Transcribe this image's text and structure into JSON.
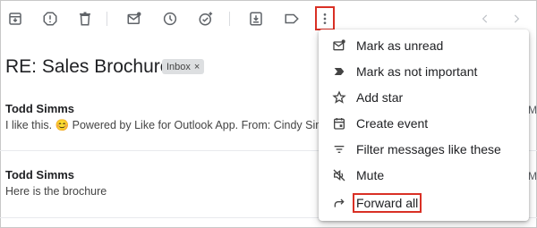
{
  "toolbar": {
    "icons": [
      "archive-icon",
      "report-spam-icon",
      "delete-icon",
      "mark-unread-icon",
      "snooze-icon",
      "add-task-icon",
      "move-to-icon",
      "label-icon",
      "more-options-icon",
      "previous-icon",
      "next-icon"
    ]
  },
  "email": {
    "subject": "RE: Sales Brochure",
    "label_chip": "Inbox",
    "chip_close": "×"
  },
  "messages": [
    {
      "sender": "Todd Simms",
      "snippet": "I like this. 😊 Powered by Like for Outlook App. From: Cindy Simm",
      "right_edge": "M"
    },
    {
      "sender": "Todd Simms",
      "snippet": "Here is the brochure",
      "right_edge": "M"
    }
  ],
  "menu": {
    "items": [
      {
        "label": "Mark as unread",
        "icon": "mark-unread-icon"
      },
      {
        "label": "Mark as not important",
        "icon": "not-important-icon"
      },
      {
        "label": "Add star",
        "icon": "star-icon"
      },
      {
        "label": "Create event",
        "icon": "calendar-icon"
      },
      {
        "label": "Filter messages like these",
        "icon": "filter-icon"
      },
      {
        "label": "Mute",
        "icon": "mute-icon"
      },
      {
        "label": "Forward all",
        "icon": "forward-icon"
      }
    ]
  },
  "colors": {
    "highlight": "#d93025",
    "icon": "#5f6368"
  }
}
